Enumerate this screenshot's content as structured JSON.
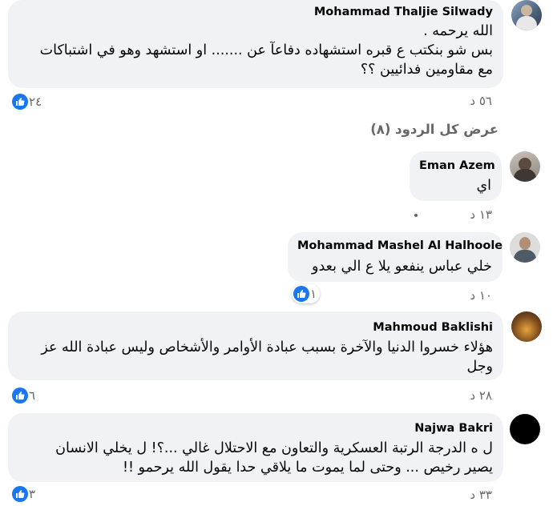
{
  "comments": [
    {
      "author": "Mohammad Thaljie Silwady",
      "lines": [
        "الله يرحمه .",
        "بس شو بنكتب ع قبره استشهاده دفاعآ عن ....... او استشهد وهو في اشتباكات",
        "مع مقاومين فدائيين ؟؟"
      ],
      "time": "٥٦ د",
      "likes": "٢٤"
    },
    {
      "author": "Eman Azem",
      "lines": [
        "اي"
      ],
      "time": "١٣ د"
    },
    {
      "author": "Mohammad Mashel Al Halhoole",
      "lines": [
        "خلي عباس ينفعو يلا ع الي بعدو"
      ],
      "time": "١٠ د",
      "likes": "١"
    },
    {
      "author": "Mahmoud Baklishi",
      "lines": [
        "هؤلاء خسروا الدنيا والآخرة بسبب عبادة الأوامر والأشخاص وليس عبادة الله عز",
        "وجل"
      ],
      "time": "٢٨ د",
      "likes": "٦"
    },
    {
      "author": "Najwa Bakri",
      "lines": [
        "ل ه الدرجة الرتبة العسكرية والتعاون مع الاحتلال غالي ...؟! ل يخلي الانسان",
        "يصير رخيص ... وحتى لما يموت ما يلاقي حدا يقول الله يرحمو !!"
      ],
      "time": "٣٣ د",
      "likes": "٣"
    }
  ],
  "view_replies": "عرض كل الردود (٨)",
  "colors": {
    "bubble": "#f0f2f5",
    "like": "#1877f2",
    "meta": "#65676b"
  },
  "icons": [
    "like-icon",
    "avatar"
  ]
}
